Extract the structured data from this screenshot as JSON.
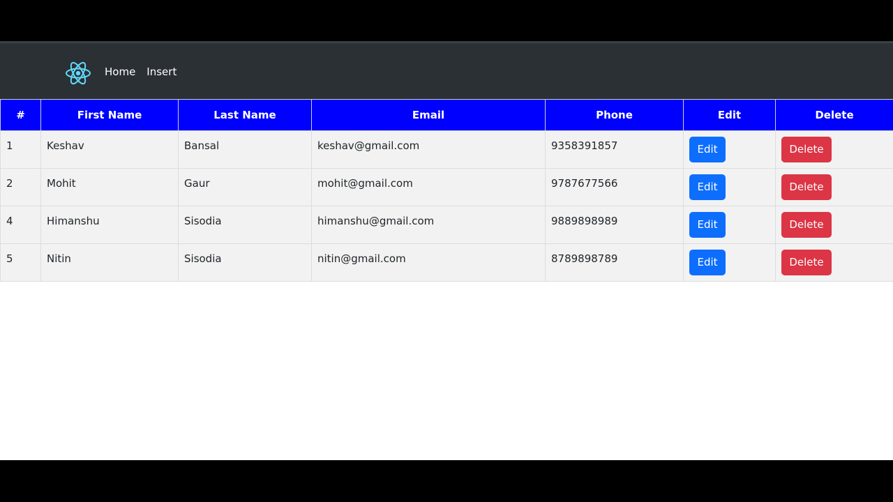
{
  "navbar": {
    "logo_icon": "react-logo-icon",
    "logo_color": "#61dafb",
    "links": [
      {
        "label": "Home"
      },
      {
        "label": "Insert"
      }
    ]
  },
  "table": {
    "headers": [
      "#",
      "First Name",
      "Last Name",
      "Email",
      "Phone",
      "Edit",
      "Delete"
    ],
    "header_color": "#0000ff",
    "rows": [
      {
        "id": "1",
        "first_name": "Keshav",
        "last_name": "Bansal",
        "email": "keshav@gmail.com",
        "phone": "9358391857",
        "edit_label": "Edit",
        "delete_label": "Delete"
      },
      {
        "id": "2",
        "first_name": "Mohit",
        "last_name": "Gaur",
        "email": "mohit@gmail.com",
        "phone": "9787677566",
        "edit_label": "Edit",
        "delete_label": "Delete"
      },
      {
        "id": "4",
        "first_name": "Himanshu",
        "last_name": "Sisodia",
        "email": "himanshu@gmail.com",
        "phone": "9889898989",
        "edit_label": "Edit",
        "delete_label": "Delete"
      },
      {
        "id": "5",
        "first_name": "Nitin",
        "last_name": "Sisodia",
        "email": "nitin@gmail.com",
        "phone": "8789898789",
        "edit_label": "Edit",
        "delete_label": "Delete"
      }
    ],
    "edit_button_color": "#0d6efd",
    "delete_button_color": "#dc3545"
  }
}
